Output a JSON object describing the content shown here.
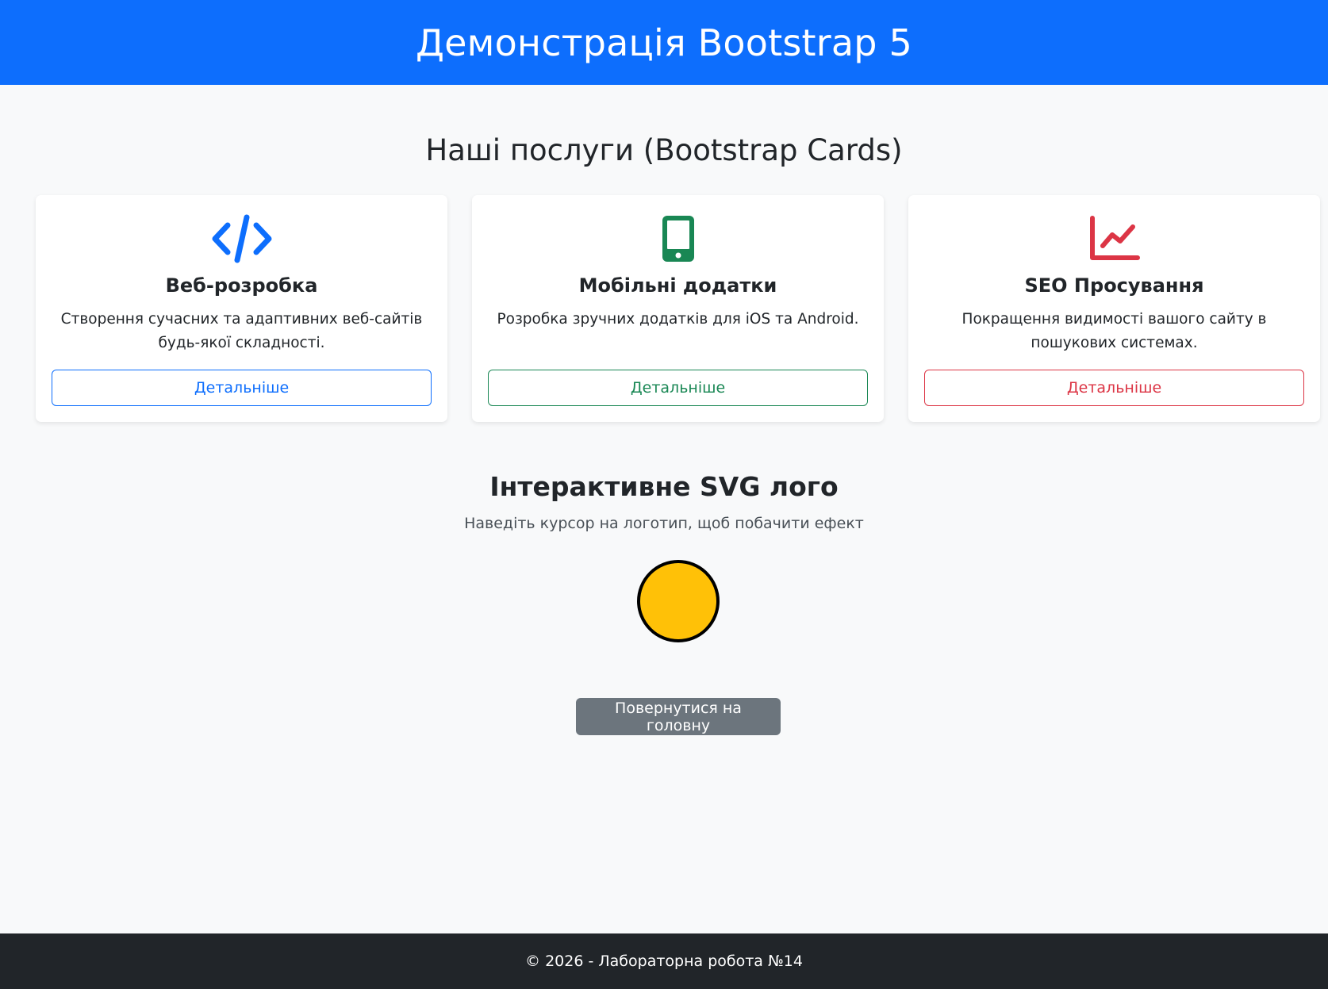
{
  "header": {
    "title": "Демонстрація Bootstrap 5"
  },
  "services": {
    "heading": "Наші послуги (Bootstrap Cards)",
    "cards": [
      {
        "icon": "code-icon",
        "title": "Веб-розробка",
        "text": "Створення сучасних та адаптивних веб-сайтів будь-якої складності.",
        "button_label": "Детальніше",
        "color": "#0d6efd"
      },
      {
        "icon": "phone-icon",
        "title": "Мобільні додатки",
        "text": "Розробка зручних додатків для iOS та Android.",
        "button_label": "Детальніше",
        "color": "#198754"
      },
      {
        "icon": "chart-icon",
        "title": "SEO Просування",
        "text": "Покращення видимості вашого сайту в пошукових системах.",
        "button_label": "Детальніше",
        "color": "#dc3545"
      }
    ]
  },
  "svg_section": {
    "title": "Інтерактивне SVG лого",
    "subtitle": "Наведіть курсор на логотип, щоб побачити ефект",
    "logo_color": "#ffc107"
  },
  "home_button": {
    "label": "Повернутися на головну"
  },
  "footer": {
    "text": "© 2026 - Лабораторна робота №14"
  }
}
